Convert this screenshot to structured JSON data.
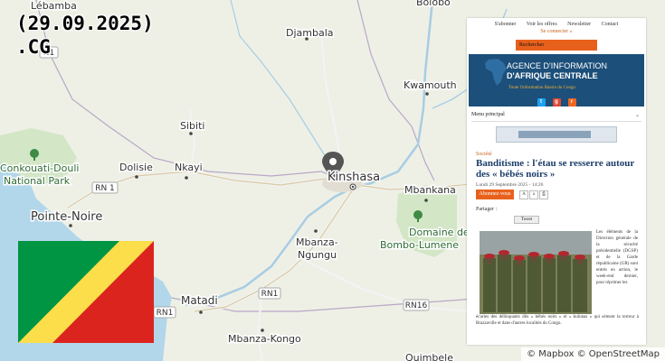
{
  "overlay": {
    "date": "(29.09.2025)",
    "tld": ".CG"
  },
  "map": {
    "places": [
      {
        "name": "Lébamba"
      },
      {
        "name": "Bolobo"
      },
      {
        "name": "Djambala"
      },
      {
        "name": "Kwamouth"
      },
      {
        "name": "Sibiti"
      },
      {
        "name": "Conkouati-Douli National Park"
      },
      {
        "name": "Dolisie"
      },
      {
        "name": "Nkayi"
      },
      {
        "name": "Kinshasa"
      },
      {
        "name": "Mbankana"
      },
      {
        "name": "Pointe-Noire"
      },
      {
        "name": "Mbanza-Ngungu"
      },
      {
        "name": "Domaine de Bombo-Lumene"
      },
      {
        "name": "Matadi"
      },
      {
        "name": "Mbanza-Kongo"
      },
      {
        "name": "Quimbele"
      }
    ],
    "road_shields": [
      "RN 1",
      "RN1",
      "RN1",
      "RN16",
      "N1"
    ],
    "park_icon": "tree-icon",
    "marker_icon": "map-pin-icon"
  },
  "flag": {
    "colors": {
      "green": "#009543",
      "yellow": "#fbde4a",
      "red": "#dc241f"
    }
  },
  "attribution": "© Mapbox © OpenStreetMap",
  "article": {
    "nav": [
      "S'abonner",
      "Voir les offres",
      "Newsletter",
      "Contact"
    ],
    "connect": "Se connecter »",
    "search_placeholder": "Rechercher",
    "banner_line1": "AGENCE D'INFORMATION",
    "banner_line2": "D'AFRIQUE CENTRALE",
    "banner_tagline": "Toute l'information Bassin du Congo",
    "menu_label": "Menu principal",
    "category": "Société",
    "headline": "Banditisme : l'étau se resserre autour des « bébés noirs »",
    "meta": "Lundi 29 Septembre 2025 - 14:26",
    "follow": "Abonnez-vous",
    "font_sizes": [
      "A",
      "a"
    ],
    "share_label": "Partager :",
    "tweet_label": "Tweet",
    "body_side": "Les éléments de la Direction générale de la sécurité présidentielle (DGSP) et de la Garde républicaine (GR) sont entrés en action, le week-end dernier, pour réprimer les",
    "body_bottom": "écuries des délinquants dits « bébés noirs » et « kulunas » qui sèment la terreur à Brazzaville et dans d'autres localités du Congo."
  }
}
